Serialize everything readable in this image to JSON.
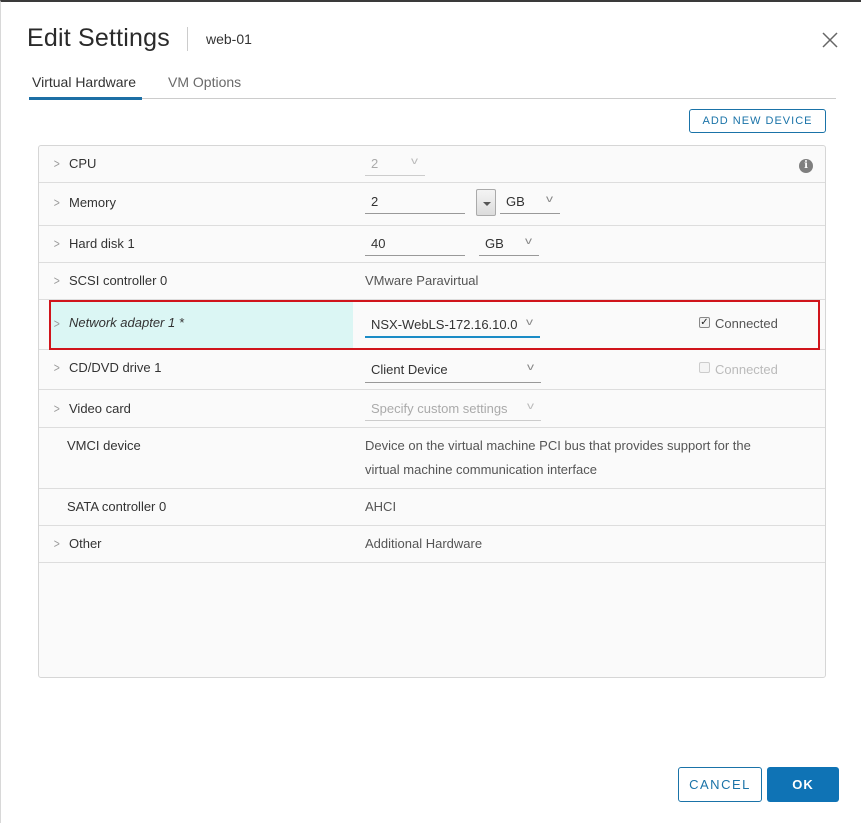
{
  "dialog": {
    "title": "Edit Settings",
    "vm_name": "web-01",
    "close_icon": "close-icon"
  },
  "tabs": [
    {
      "label": "Virtual Hardware",
      "active": true
    },
    {
      "label": "VM Options",
      "active": false
    }
  ],
  "toolbar": {
    "add_new_device_label": "ADD NEW DEVICE"
  },
  "hardware": {
    "cpu": {
      "label": "CPU",
      "value": "2",
      "info_icon": "i"
    },
    "memory": {
      "label": "Memory",
      "value": "2",
      "unit": "GB"
    },
    "hard_disk": {
      "label": "Hard disk 1",
      "value": "40",
      "unit": "GB"
    },
    "scsi": {
      "label": "SCSI controller 0",
      "value": "VMware Paravirtual"
    },
    "network": {
      "label": "Network adapter 1 *",
      "value": "NSX-WebLS-172.16.10.0",
      "connected_label": "Connected",
      "connected": true
    },
    "cdrom": {
      "label": "CD/DVD drive 1",
      "value": "Client Device",
      "connected_label": "Connected",
      "connected": false
    },
    "video": {
      "label": "Video card",
      "value": "Specify custom settings"
    },
    "vmci": {
      "label": "VMCI device",
      "value_line1": "Device on the virtual machine PCI bus that provides support for the",
      "value_line2": "virtual machine communication interface"
    },
    "sata": {
      "label": "SATA controller 0",
      "value": "AHCI"
    },
    "other": {
      "label": "Other",
      "value": "Additional Hardware"
    }
  },
  "footer": {
    "cancel_label": "CANCEL",
    "ok_label": "OK"
  },
  "colors": {
    "accent": "#0f73b5",
    "highlight": "#dbf6f4",
    "annotation_box": "#d0141b"
  }
}
